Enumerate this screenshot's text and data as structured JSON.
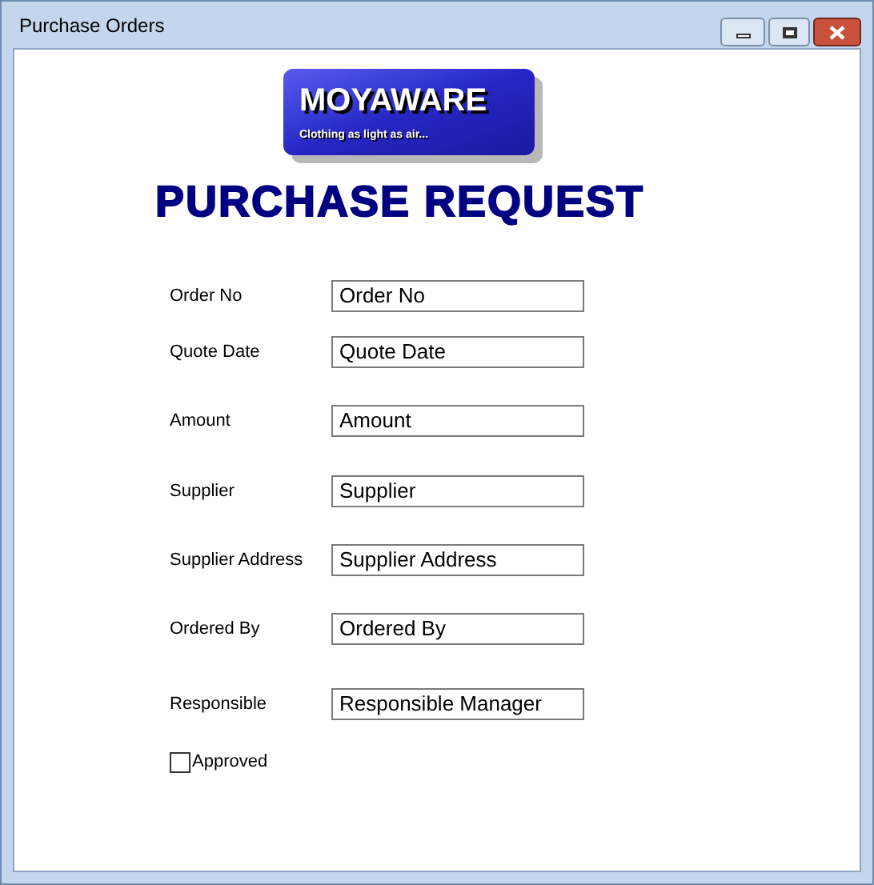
{
  "window": {
    "title": "Purchase Orders"
  },
  "logo": {
    "name": "MOYAWARE",
    "tagline": "Clothing as light as air..."
  },
  "heading": "PURCHASE REQUEST",
  "fields": [
    {
      "label": "Order No",
      "value": "Order No"
    },
    {
      "label": "Quote Date",
      "value": "Quote Date"
    },
    {
      "label": "Amount",
      "value": "Amount"
    },
    {
      "label": "Supplier",
      "value": "Supplier"
    },
    {
      "label": "Supplier Address",
      "value": "Supplier Address"
    },
    {
      "label": "Ordered By",
      "value": "Ordered By"
    },
    {
      "label": "Responsible",
      "value": "Responsible Manager"
    }
  ],
  "approved": {
    "label": "Approved",
    "checked": false
  }
}
